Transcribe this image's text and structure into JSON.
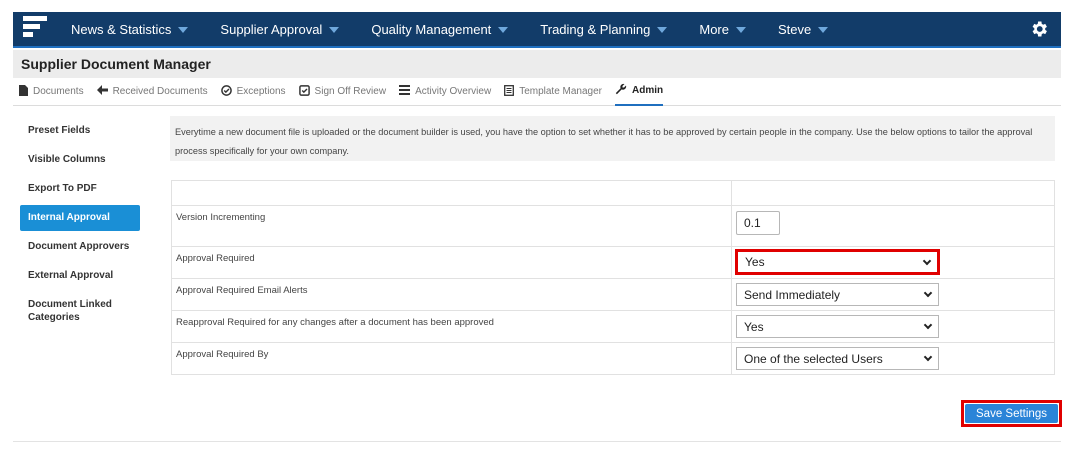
{
  "nav": {
    "items": [
      {
        "label": "News & Statistics"
      },
      {
        "label": "Supplier Approval"
      },
      {
        "label": "Quality Management"
      },
      {
        "label": "Trading & Planning"
      },
      {
        "label": "More"
      },
      {
        "label": "Steve"
      }
    ]
  },
  "header": {
    "title": "Supplier Document Manager"
  },
  "tabs": [
    {
      "label": "Documents",
      "icon": "file-icon"
    },
    {
      "label": "Received Documents",
      "icon": "arrow-left-icon"
    },
    {
      "label": "Exceptions",
      "icon": "check-circle-icon"
    },
    {
      "label": "Sign Off Review",
      "icon": "check-square-icon"
    },
    {
      "label": "Activity Overview",
      "icon": "list-icon"
    },
    {
      "label": "Template Manager",
      "icon": "template-icon"
    },
    {
      "label": "Admin",
      "icon": "wrench-icon"
    }
  ],
  "sidebar": {
    "items": [
      {
        "label": "Preset Fields"
      },
      {
        "label": "Visible Columns"
      },
      {
        "label": "Export To PDF"
      },
      {
        "label": "Internal Approval"
      },
      {
        "label": "Document Approvers"
      },
      {
        "label": "External Approval"
      },
      {
        "label": "Document Linked Categories"
      }
    ]
  },
  "info": {
    "text": "Everytime a new document file is uploaded or the document builder is used, you have the option to set whether it has to be approved by certain people in the company. Use the below options to tailor the approval process specifically for your own company."
  },
  "settings": {
    "version_label": "Version Incrementing",
    "version_value": "0.1",
    "approval_label": "Approval Required",
    "approval_value": "Yes",
    "alerts_label": "Approval Required Email Alerts",
    "alerts_value": "Send Immediately",
    "reapproval_label": "Reapproval Required for any changes after a document has been approved",
    "reapproval_value": "Yes",
    "by_label": "Approval Required By",
    "by_value": "One of the selected Users"
  },
  "actions": {
    "save_label": "Save Settings"
  },
  "colors": {
    "nav_bg": "#123c69",
    "accent": "#1a8fd6",
    "highlight": "#e00000"
  }
}
